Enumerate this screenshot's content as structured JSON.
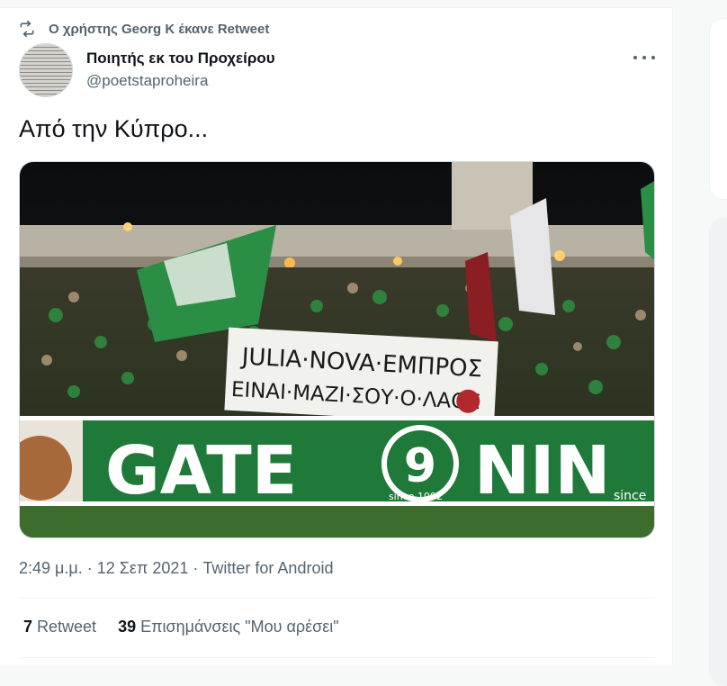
{
  "retweet_notice": "Ο χρήστης Georg K έκανε Retweet",
  "author": {
    "display_name": "Ποιητής εκ του Προχείρου",
    "handle": "@poetstaproheira"
  },
  "tweet_text": "Από την Κύπρο...",
  "media": {
    "banner_line1": "JULIA·NOVA·ΕΜΠΡΟΣ",
    "banner_line2": "ΕΙΝΑΙ·ΜΑΖΙ·ΣΟΥ·Ο·ΛΑΟΣ",
    "big_banner_left": "GATE",
    "big_banner_right": "NIN",
    "badge_number": "9",
    "badge_since": "since 1992",
    "right_since": "since"
  },
  "meta_line": "2:49 μ.μ. · 12 Σεπ 2021 · Twitter for Android",
  "stats": {
    "retweets_count": "7",
    "retweets_label": "Retweet",
    "likes_count": "39",
    "likes_label": "Επισημάνσεις \"Μου αρέσει\""
  },
  "colors": {
    "text_primary": "#0f1419",
    "text_secondary": "#536471",
    "banner_green": "#1f7a3a"
  },
  "icons": [
    "retweet-icon",
    "more-options-icon"
  ]
}
